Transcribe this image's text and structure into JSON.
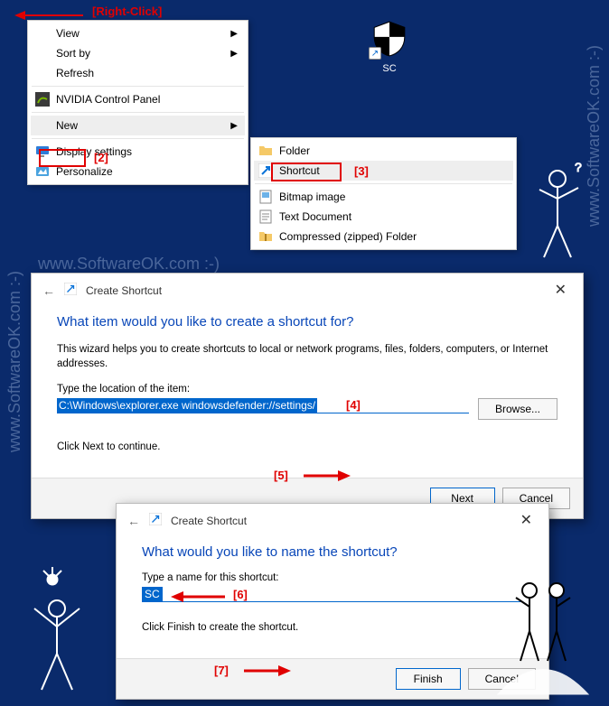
{
  "annotations": {
    "rightclick": "[Right-Click]",
    "m2": "[2]",
    "m3": "[3]",
    "m4": "[4]",
    "m5": "[5]",
    "m6": "[6]",
    "m7": "[7]"
  },
  "watermark": "www.SoftwareOK.com :-)",
  "desktop_icon": {
    "label": "SC"
  },
  "context_menu_1": {
    "items": [
      {
        "label": "View",
        "has_arrow": true
      },
      {
        "label": "Sort by",
        "has_arrow": true
      },
      {
        "label": "Refresh"
      }
    ],
    "items2": [
      {
        "label": "NVIDIA Control Panel",
        "icon": "nvidia"
      }
    ],
    "new_label": "New",
    "items3": [
      {
        "label": "Display settings",
        "icon": "display"
      },
      {
        "label": "Personalize",
        "icon": "personalize"
      }
    ]
  },
  "context_menu_2": {
    "items": [
      {
        "label": "Folder",
        "icon": "folder"
      },
      {
        "label": "Shortcut",
        "icon": "shortcut"
      },
      {
        "label": "Bitmap image",
        "icon": "bitmap"
      },
      {
        "label": "Text Document",
        "icon": "text"
      },
      {
        "label": "Compressed (zipped) Folder",
        "icon": "zip"
      }
    ]
  },
  "dialog1": {
    "title": "Create Shortcut",
    "heading": "What item would you like to create a shortcut for?",
    "desc": "This wizard helps you to create shortcuts to local or network programs, files, folders, computers, or Internet addresses.",
    "label_location": "Type the location of the item:",
    "location_value": "C:\\Windows\\explorer.exe windowsdefender://settings/",
    "browse": "Browse...",
    "continue_hint": "Click Next to continue.",
    "next": "Next",
    "cancel": "Cancel"
  },
  "dialog2": {
    "title": "Create Shortcut",
    "heading": "What would you like to name the shortcut?",
    "label_name": "Type a name for this shortcut:",
    "name_value": "SC",
    "finish_hint": "Click Finish to create the shortcut.",
    "finish": "Finish",
    "cancel": "Cancel"
  }
}
